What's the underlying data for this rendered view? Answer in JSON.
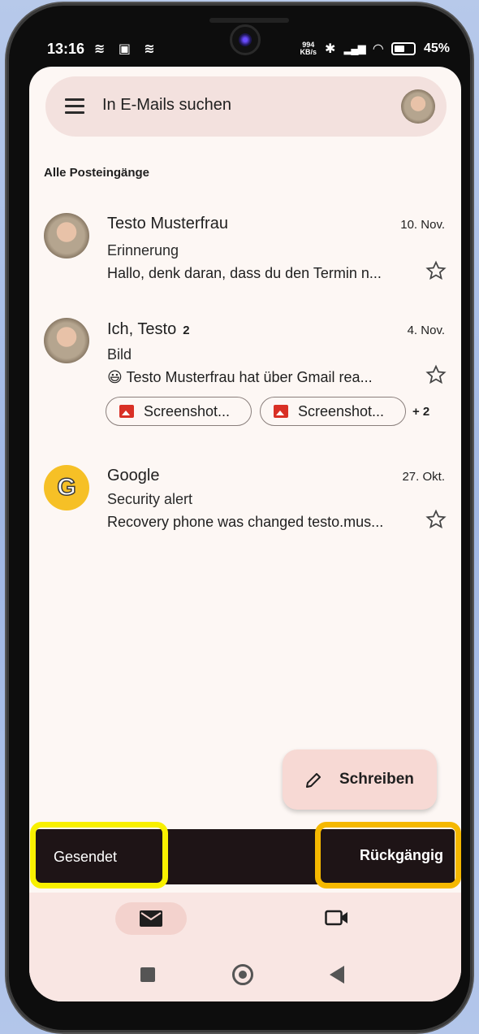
{
  "status_bar": {
    "time": "13:16",
    "left_icons": "≋ ▣ ≋",
    "net_speed_value": "994",
    "net_speed_unit": "KB/s",
    "battery": "45%"
  },
  "search": {
    "placeholder": "In E-Mails suchen"
  },
  "section_title": "Alle Posteingänge",
  "mails": [
    {
      "sender": "Testo Musterfrau",
      "count": "",
      "date": "10. Nov.",
      "subject": "Erinnerung",
      "snippet": "Hallo, denk daran, dass du den Termin n..."
    },
    {
      "sender": "Ich, Testo",
      "count": "2",
      "date": "4. Nov.",
      "subject": "Bild",
      "snippet": "😃 Testo Musterfrau hat über Gmail rea...",
      "attachments": [
        "Screenshot...",
        "Screenshot..."
      ],
      "more_attachments": "+ 2"
    },
    {
      "sender": "Google",
      "count": "",
      "date": "27. Okt.",
      "subject": "Security alert",
      "snippet": "Recovery phone was changed testo.mus...",
      "avatar_letter": "G"
    }
  ],
  "fab": {
    "label": "Schreiben",
    "icon": "pencil-icon"
  },
  "snackbar": {
    "message": "Gesendet",
    "action": "Rückgängig"
  },
  "highlight_colors": {
    "message": "#f8f000",
    "action": "#f5b800"
  },
  "bottom_nav": {
    "items": [
      "mail-icon",
      "video-icon"
    ]
  }
}
